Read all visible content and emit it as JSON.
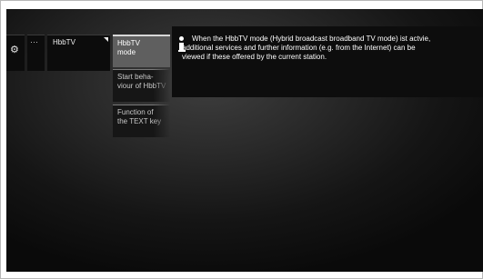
{
  "menu_bar": {
    "settings_icon": "gear-icon",
    "more_label": "···",
    "hbbtv_label": "HbbTV"
  },
  "submenu": {
    "items": [
      {
        "line1": "HbbTV",
        "line2": "mode"
      },
      {
        "line1": "Start beha-",
        "line2": "viour of HbbTV"
      },
      {
        "line1": "Function of",
        "line2": "the TEXT key"
      }
    ]
  },
  "info": {
    "icon": "info-icon",
    "text": "When the HbbTV mode (Hybrid broadcast broadband TV mode) ist actvie, additional services and further information (e.g. from the Internet) can be viewed if these offered by the current station."
  },
  "colors": {
    "screen_background": "#1a1a1a",
    "selected_item": "#5f5f5f",
    "text": "#ffffff"
  }
}
